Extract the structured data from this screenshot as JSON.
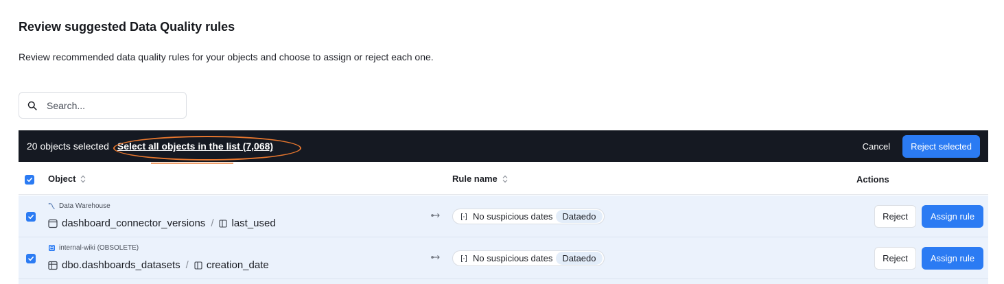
{
  "page": {
    "title": "Review suggested Data Quality rules",
    "description": "Review recommended data quality rules for your objects and choose to assign or reject each one."
  },
  "search": {
    "placeholder": "Search...",
    "value": ""
  },
  "selection_bar": {
    "count_text": "20 objects selected",
    "select_all_text": "Select all objects in the list (7,068)",
    "cancel_label": "Cancel",
    "reject_selected_label": "Reject selected",
    "highlight_color": "#e8772e"
  },
  "table": {
    "columns": {
      "object": "Object",
      "rule_name": "Rule name",
      "actions": "Actions"
    },
    "rows": [
      {
        "source": "Data Warehouse",
        "source_icon": "data-warehouse-icon",
        "object_icon": "table-window-icon",
        "object": "dashboard_connector_versions",
        "column": "last_used",
        "rule": "No suspicious dates",
        "rule_source": "Dataedo",
        "reject_label": "Reject",
        "assign_label": "Assign rule",
        "checked": true
      },
      {
        "source": "internal-wiki (OBSOLETE)",
        "source_icon": "database-icon",
        "object_icon": "table-grid-icon",
        "object": "dbo.dashboards_datasets",
        "column": "creation_date",
        "rule": "No suspicious dates",
        "rule_source": "Dataedo",
        "reject_label": "Reject",
        "assign_label": "Assign rule",
        "checked": true
      }
    ]
  },
  "colors": {
    "accent": "#2b7bf3",
    "bar_bg": "#151922",
    "row_selected_bg": "#ebf2fc"
  }
}
